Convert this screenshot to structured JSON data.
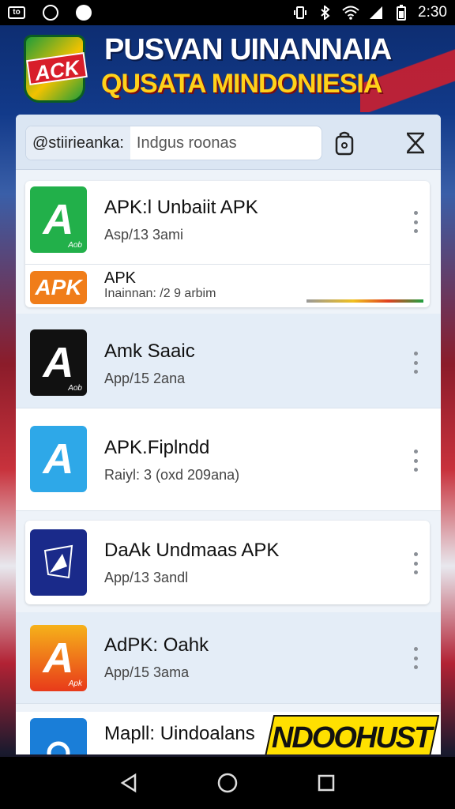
{
  "status_bar": {
    "time": "2:30",
    "left_icons": [
      "notification-box-icon",
      "circle-icon",
      "dot-icon"
    ],
    "right_icons": [
      "vibrate-icon",
      "bluetooth-icon",
      "wifi-icon",
      "signal-icon",
      "battery-icon"
    ]
  },
  "banner": {
    "logo_text": "ACK",
    "title": "PUSVAN UINANNAIA",
    "subtitle": "QUSATA MINDONIESIA"
  },
  "search": {
    "prefix": "@stiirieanka:",
    "placeholder": "Indgus roonas"
  },
  "apps": [
    {
      "name": "APK:l Unbaiit APK",
      "meta": "Asp/13 3ami",
      "icon_tag": "",
      "icon_sub": "Aob",
      "glyph": "A",
      "color": "#22b04a"
    },
    {
      "name": "APK",
      "meta": "Inainnan: /2 9 arbim",
      "icon_tag": "",
      "icon_sub": "",
      "glyph": "APK",
      "color": "#f07d1a"
    },
    {
      "name": "Amk Saaic",
      "meta": "App/15 2ana",
      "icon_tag": "",
      "icon_sub": "Aob",
      "glyph": "A",
      "color": "#111111"
    },
    {
      "name": "APK.Fiplndd",
      "meta": "Raiyl: 3 (oxd 209ana)",
      "icon_tag": "",
      "icon_sub": "",
      "glyph": "A",
      "color": "#2ea8e8"
    },
    {
      "name": "DaAk Undmaas APK",
      "meta": "App/13 3andl",
      "icon_tag": "",
      "icon_sub": "",
      "glyph": "",
      "color": "#1a2a8a"
    },
    {
      "name": "AdPK: Oahk",
      "meta": "App/15 3ama",
      "icon_tag": "",
      "icon_sub": "Apk",
      "glyph": "A",
      "color": "#f08a1a"
    },
    {
      "name": "Mapll: Uindoalans",
      "meta": "",
      "icon_tag": "",
      "icon_sub": "",
      "glyph": "",
      "color": "#1a7ed8"
    }
  ],
  "promo": {
    "text": "NDOOHUST"
  },
  "nav": {
    "back": "back-icon",
    "home": "home-icon",
    "recents": "recents-icon"
  }
}
